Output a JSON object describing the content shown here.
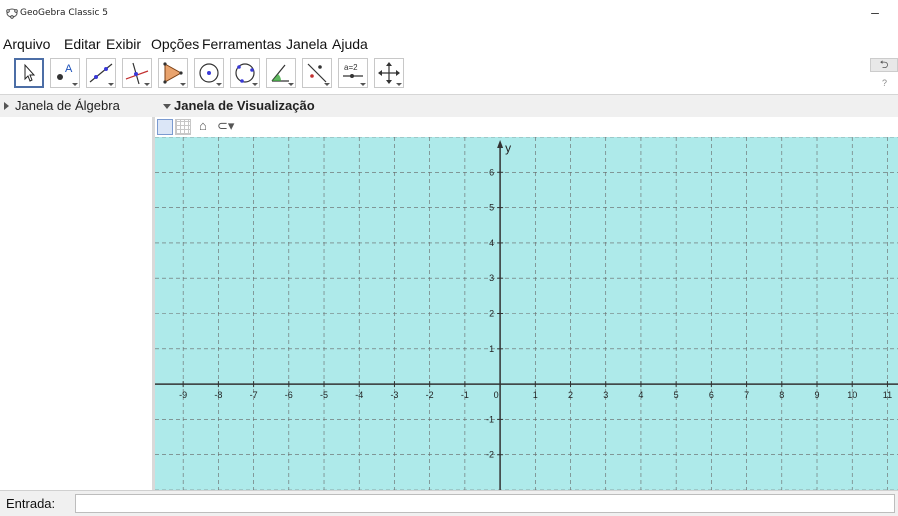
{
  "window": {
    "title": "GeoGebra Classic 5",
    "minimize_glyph": "–"
  },
  "menu": [
    "Arquivo",
    "Editar",
    "Exibir",
    "Opções",
    "Ferramentas",
    "Janela",
    "Ajuda"
  ],
  "toolbar": {
    "tools": [
      {
        "name": "move-tool",
        "icon": "arrow-cursor-icon",
        "selected": true
      },
      {
        "name": "point-tool",
        "icon": "point-icon",
        "label": "A"
      },
      {
        "name": "line-tool",
        "icon": "line-icon"
      },
      {
        "name": "perpendicular-tool",
        "icon": "perpendicular-icon"
      },
      {
        "name": "polygon-tool",
        "icon": "polygon-icon"
      },
      {
        "name": "circle-tool",
        "icon": "circle-icon"
      },
      {
        "name": "circle-three-points-tool",
        "icon": "circle-three-points-icon"
      },
      {
        "name": "angle-tool",
        "icon": "angle-icon"
      },
      {
        "name": "reflect-tool",
        "icon": "reflect-icon"
      },
      {
        "name": "slider-tool",
        "icon": "slider-icon",
        "label": "a=2"
      },
      {
        "name": "move-view-tool",
        "icon": "move-view-icon"
      }
    ],
    "undo_glyph": "⮌",
    "help_glyph": "?"
  },
  "algebra": {
    "title": "Janela de Álgebra"
  },
  "graphics": {
    "title": "Janela de Visualização",
    "background": "#aeeaea",
    "x_ticks": [
      -9,
      -8,
      -7,
      -6,
      -5,
      -4,
      -3,
      -2,
      -1,
      0,
      1,
      2,
      3,
      4,
      5,
      6,
      7,
      8,
      9,
      10,
      11
    ],
    "y_ticks": [
      6,
      5,
      4,
      3,
      2,
      1,
      -1,
      -2
    ],
    "y_axis_label": "y",
    "xlim": [
      -9.8,
      11.3
    ],
    "ylim": [
      -3.0,
      7.0
    ]
  },
  "input_bar": {
    "label": "Entrada:",
    "value": ""
  }
}
